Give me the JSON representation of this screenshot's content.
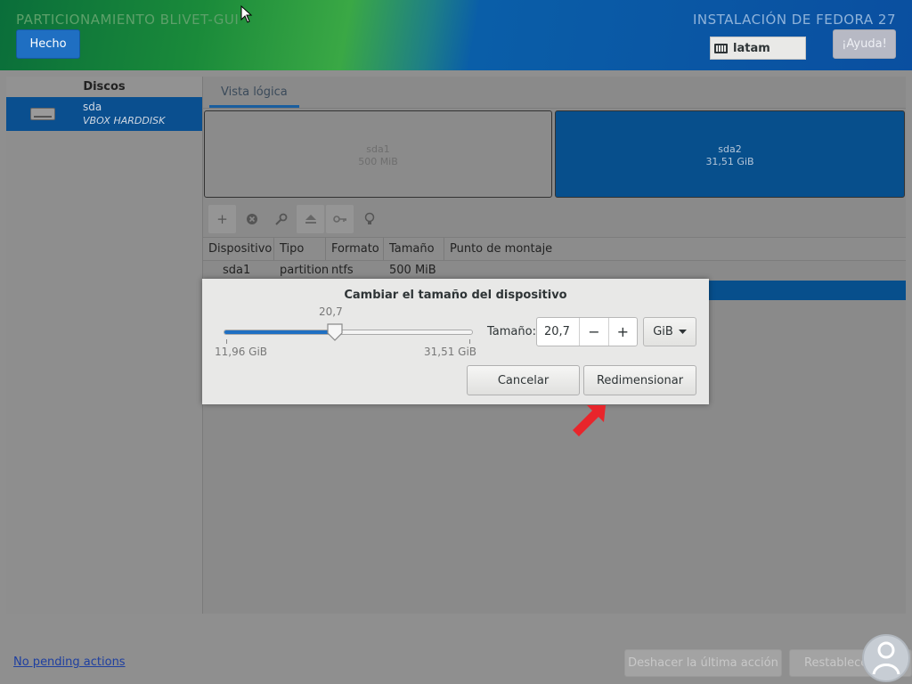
{
  "header": {
    "title": "PARTICIONAMIENTO BLIVET-GUI",
    "done_label": "Hecho",
    "install_title": "INSTALACIÓN DE FEDORA 27",
    "keyboard_layout": "latam",
    "help_label": "¡Ayuda!"
  },
  "sidebar": {
    "heading": "Discos",
    "disk": {
      "name": "sda",
      "model": "VBOX HARDDISK"
    }
  },
  "view": {
    "tab_label": "Vista lógica",
    "partitions": [
      {
        "name": "sda1",
        "size": "500 MiB"
      },
      {
        "name": "sda2",
        "size": "31,51 GiB"
      }
    ]
  },
  "toolbar": {
    "icons": [
      "add-icon",
      "delete-icon",
      "settings-icon",
      "eject-icon",
      "key-icon",
      "lightbulb-icon"
    ]
  },
  "table": {
    "columns": [
      "Dispositivo",
      "Tipo",
      "Formato",
      "Tamaño",
      "Punto de montaje"
    ],
    "rows": [
      {
        "device": "sda1",
        "type": "partition",
        "format": "ntfs",
        "size": "500 MiB",
        "mount": ""
      }
    ]
  },
  "dialog": {
    "title": "Cambiar el tamaño del dispositivo",
    "slider_value": "20,7",
    "slider_min": "11,96 GiB",
    "slider_max": "31,51 GiB",
    "slider_fraction": 0.446,
    "size_label": "Tamaño:",
    "size_value": "20,7",
    "minus": "−",
    "plus": "+",
    "unit": "GiB",
    "cancel_label": "Cancelar",
    "resize_label": "Redimensionar"
  },
  "footer": {
    "pending": "No pending actions",
    "undo_label": "Deshacer la última acción",
    "reset_label": "Restablecer"
  },
  "colors": {
    "accent": "#1f6fc2",
    "selection": "#074f8c",
    "annotation_arrow": "#e8252b"
  }
}
